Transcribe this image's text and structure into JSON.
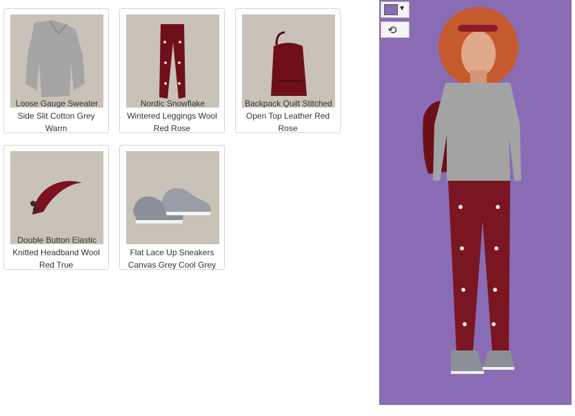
{
  "items": [
    {
      "name_line1": "Loose Gauge Sweater",
      "name_rest": [
        "Side Slit Cotton Grey",
        "Warm"
      ],
      "icon": "sweater-icon"
    },
    {
      "name_line1": "Nordic Snowflake",
      "name_rest": [
        "Wintered Leggings Wool",
        "Red Rose"
      ],
      "icon": "leggings-icon"
    },
    {
      "name_line1": "Backpack Quilt Stitched",
      "name_rest": [
        "Open Top Leather Red",
        "Rose"
      ],
      "icon": "backpack-icon"
    },
    {
      "name_line1": "Double Button Elastic",
      "name_rest": [
        "Knitted Headband Wool",
        "Red True"
      ],
      "icon": "headband-icon"
    },
    {
      "name_line1": "Flat Lace Up Sneakers",
      "name_rest": [
        "Canvas Grey Cool Grey"
      ],
      "icon": "sneakers-icon"
    }
  ],
  "stage": {
    "background_color": "#8a6cb5",
    "color_picker_icon": "caret-down-icon",
    "rotate_icon": "rotate-icon"
  },
  "colors": {
    "thumb_bg": "#c8c2b9",
    "sweater": "#a5a5a5",
    "wine": "#6e0f1a",
    "sneaker": "#8c8f97"
  }
}
